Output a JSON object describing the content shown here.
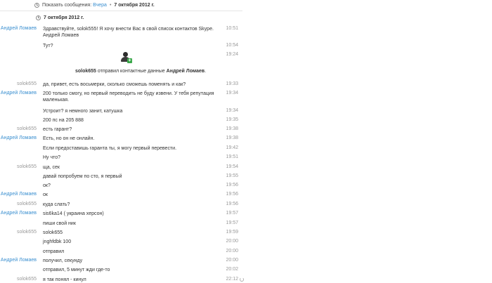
{
  "filter": {
    "label": "Показать сообщения:",
    "yesterday_link": "Вчера",
    "separator": "•",
    "current": "7 октября 2012 г."
  },
  "date_header": "7 октября 2012 г.",
  "system": {
    "contact_shared_user": "solok655",
    "contact_shared_text": "отправил контактные данные",
    "contact_shared_name": "Андрей Ломаев",
    "contact_shared_end": ".",
    "contact_time": "19:24"
  },
  "messages": [
    {
      "author": "Андрей Ломаев",
      "text": "Здравствуйте, solok555! Я хочу внести Вас в свой список контактов Skype.",
      "text2": "Андрей Ломаев",
      "time": "10:51"
    },
    {
      "author": "",
      "text": "Тут?",
      "time": "10:54"
    },
    {
      "author": "solok655",
      "text": "да, привет, есть восьмерки, сколько сможешь поменять и как?",
      "time": "19:33"
    },
    {
      "author": "Андрей Ломаев",
      "text": "200 только смогу, но первый переводить не буду извени. У тебя репутация",
      "text2": "маленькая.",
      "time": "19:34"
    },
    {
      "author": "",
      "text": "Устроит? я немного занит, катушка",
      "time": "19:34"
    },
    {
      "author": "",
      "text": "200 пс на 205 888",
      "time": "19:35"
    },
    {
      "author": "solok655",
      "text": "есть гарант?",
      "time": "19:38"
    },
    {
      "author": "Андрей Ломаев",
      "text": "Есть, но он не онлайн.",
      "time": "19:38"
    },
    {
      "author": "",
      "text": "Если предоставишь гаранта ты, я могу первый перевести.",
      "time": "19:42"
    },
    {
      "author": "",
      "text": "Ну что?",
      "time": "19:51"
    },
    {
      "author": "solok655",
      "text": "ща, сек",
      "time": "19:54"
    },
    {
      "author": "",
      "text": "давай попробуем по сто, я первый",
      "time": "19:55"
    },
    {
      "author": "",
      "text": "ок?",
      "time": "19:56"
    },
    {
      "author": "Андрей Ломаев",
      "text": "ок",
      "time": "19:56"
    },
    {
      "author": "solok655",
      "text": "куда слать?",
      "time": "19:56"
    },
    {
      "author": "Андрей Ломаев",
      "text": "sis6ka14 ( украина херсон)",
      "time": "19:57"
    },
    {
      "author": "",
      "text": "пиши свой ник",
      "time": "19:57"
    },
    {
      "author": "solok655",
      "text": "solok655",
      "time": "19:59"
    },
    {
      "author": "",
      "text": "jnghfdbk 100",
      "time": "20:00"
    },
    {
      "author": "",
      "text": "отправил",
      "time": "20:00"
    },
    {
      "author": "Андрей Ломаев",
      "text": "получил, секунду",
      "time": "20:00"
    },
    {
      "author": "",
      "text": "отправил, 5 минут жди где-то",
      "time": "20:02"
    },
    {
      "author": "solok655",
      "text": "я так понял - кинул",
      "time": "22:12"
    }
  ]
}
